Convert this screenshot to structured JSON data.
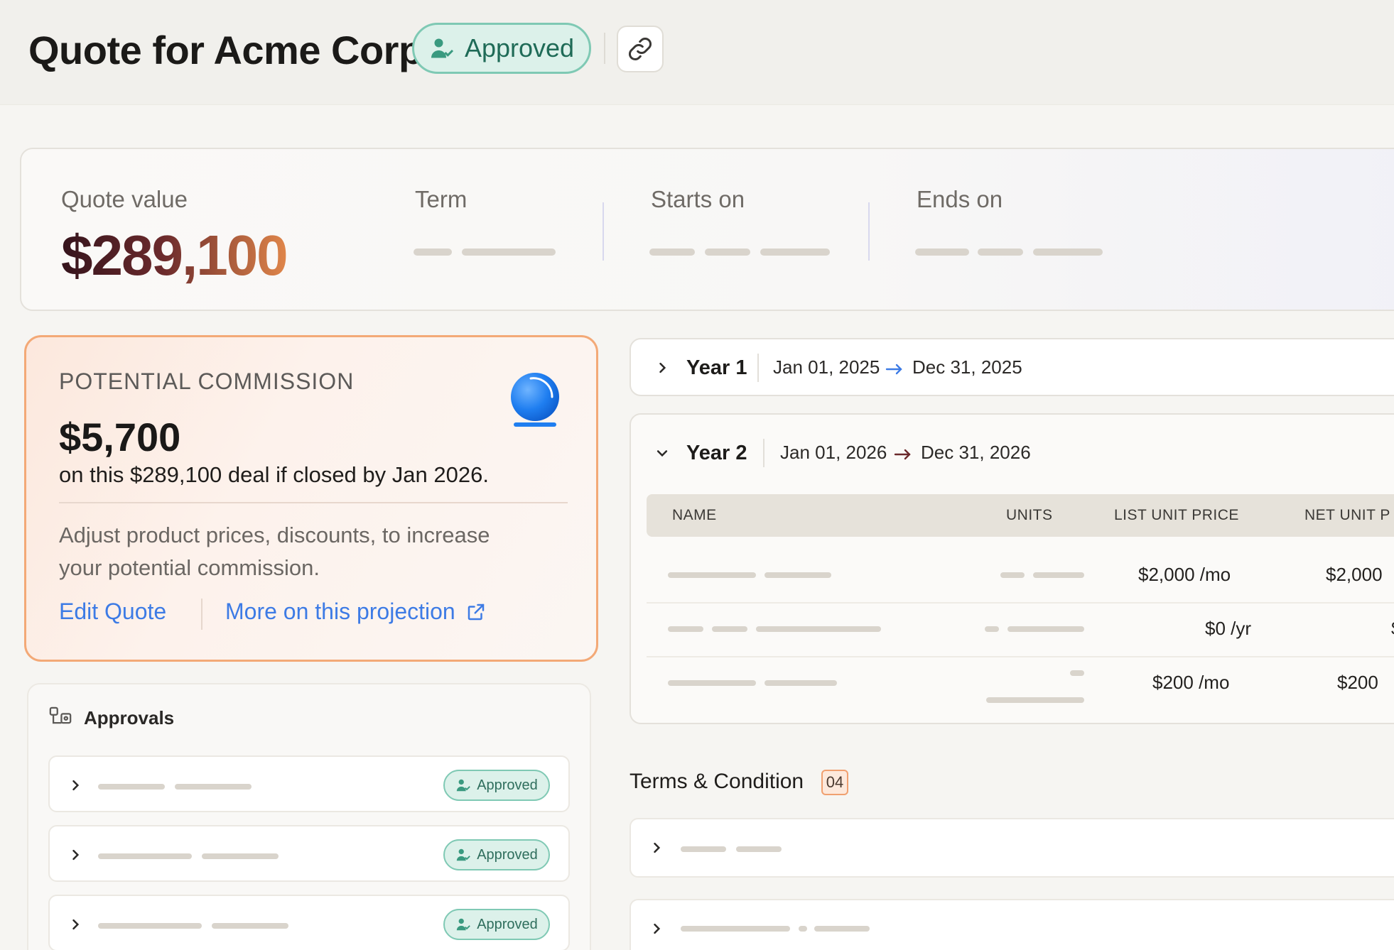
{
  "header": {
    "title": "Quote for Acme Corp",
    "status_label": "Approved",
    "status_icon": "user-check-icon",
    "link_icon": "link-icon"
  },
  "summary": {
    "quote_value_label": "Quote value",
    "quote_value": "$289,100",
    "term_label": "Term",
    "starts_on_label": "Starts on",
    "ends_on_label": "Ends on"
  },
  "commission": {
    "title": "POTENTIAL COMMISSION",
    "amount": "$5,700",
    "subtitle": "on this $289,100 deal if closed by Jan 2026.",
    "description": "Adjust product prices, discounts, to increase your potential commission.",
    "edit_link": "Edit Quote",
    "more_link": "More on this projection",
    "accent_color": "#3d7be5",
    "border_color": "#f3a977"
  },
  "approvals": {
    "title": "Approvals",
    "items": [
      {
        "status": "Approved"
      },
      {
        "status": "Approved"
      },
      {
        "status": "Approved"
      }
    ]
  },
  "years": [
    {
      "label": "Year 1",
      "start": "Jan 01, 2025",
      "end": "Dec 31, 2025",
      "expanded": false
    },
    {
      "label": "Year 2",
      "start": "Jan 01, 2026",
      "end": "Dec 31, 2026",
      "expanded": true
    }
  ],
  "table": {
    "columns": [
      "NAME",
      "UNITS",
      "LIST UNIT PRICE",
      "NET UNIT P"
    ],
    "rows": [
      {
        "list_price": "$2,000 /mo",
        "net_price": "$2,000"
      },
      {
        "list_price": "$0 /yr",
        "net_price": "$("
      },
      {
        "list_price": "$200 /mo",
        "net_price": "$200"
      }
    ]
  },
  "terms": {
    "title": "Terms & Condition",
    "count": "04"
  }
}
